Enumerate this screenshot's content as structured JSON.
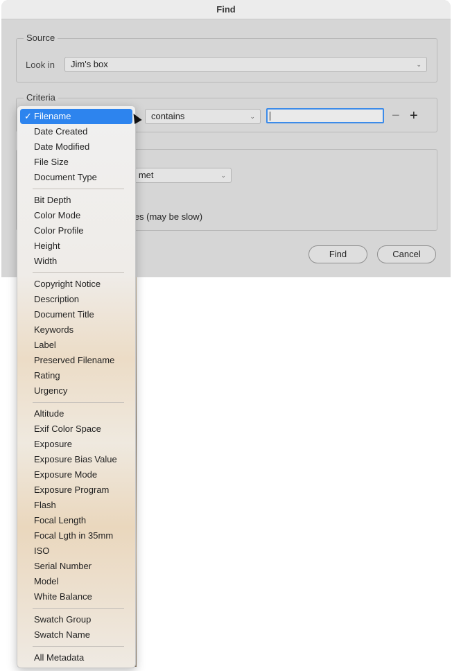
{
  "window": {
    "title": "Find"
  },
  "source": {
    "legend": "Source",
    "look_in_label": "Look in",
    "look_in_value": "Jim's box"
  },
  "criteria": {
    "legend": "Criteria",
    "operator_value": "contains",
    "text_value": "",
    "remove_label": "−",
    "add_label": "+"
  },
  "results": {
    "match_partial": "e met",
    "include_partial": "iles (may be slow)"
  },
  "buttons": {
    "find": "Find",
    "cancel": "Cancel"
  },
  "menu": {
    "selected_check": "✓",
    "groups": [
      [
        "Filename",
        "Date Created",
        "Date Modified",
        "File Size",
        "Document Type"
      ],
      [
        "Bit Depth",
        "Color Mode",
        "Color Profile",
        "Height",
        "Width"
      ],
      [
        "Copyright Notice",
        "Description",
        "Document Title",
        "Keywords",
        "Label",
        "Preserved Filename",
        "Rating",
        "Urgency"
      ],
      [
        "Altitude",
        "Exif Color Space",
        "Exposure",
        "Exposure Bias Value",
        "Exposure Mode",
        "Exposure Program",
        "Flash",
        "Focal Length",
        "Focal Lgth in 35mm",
        "ISO",
        "Serial Number",
        "Model",
        "White Balance"
      ],
      [
        "Swatch Group",
        "Swatch Name"
      ],
      [
        "All Metadata"
      ]
    ],
    "selected_item": "Filename"
  }
}
